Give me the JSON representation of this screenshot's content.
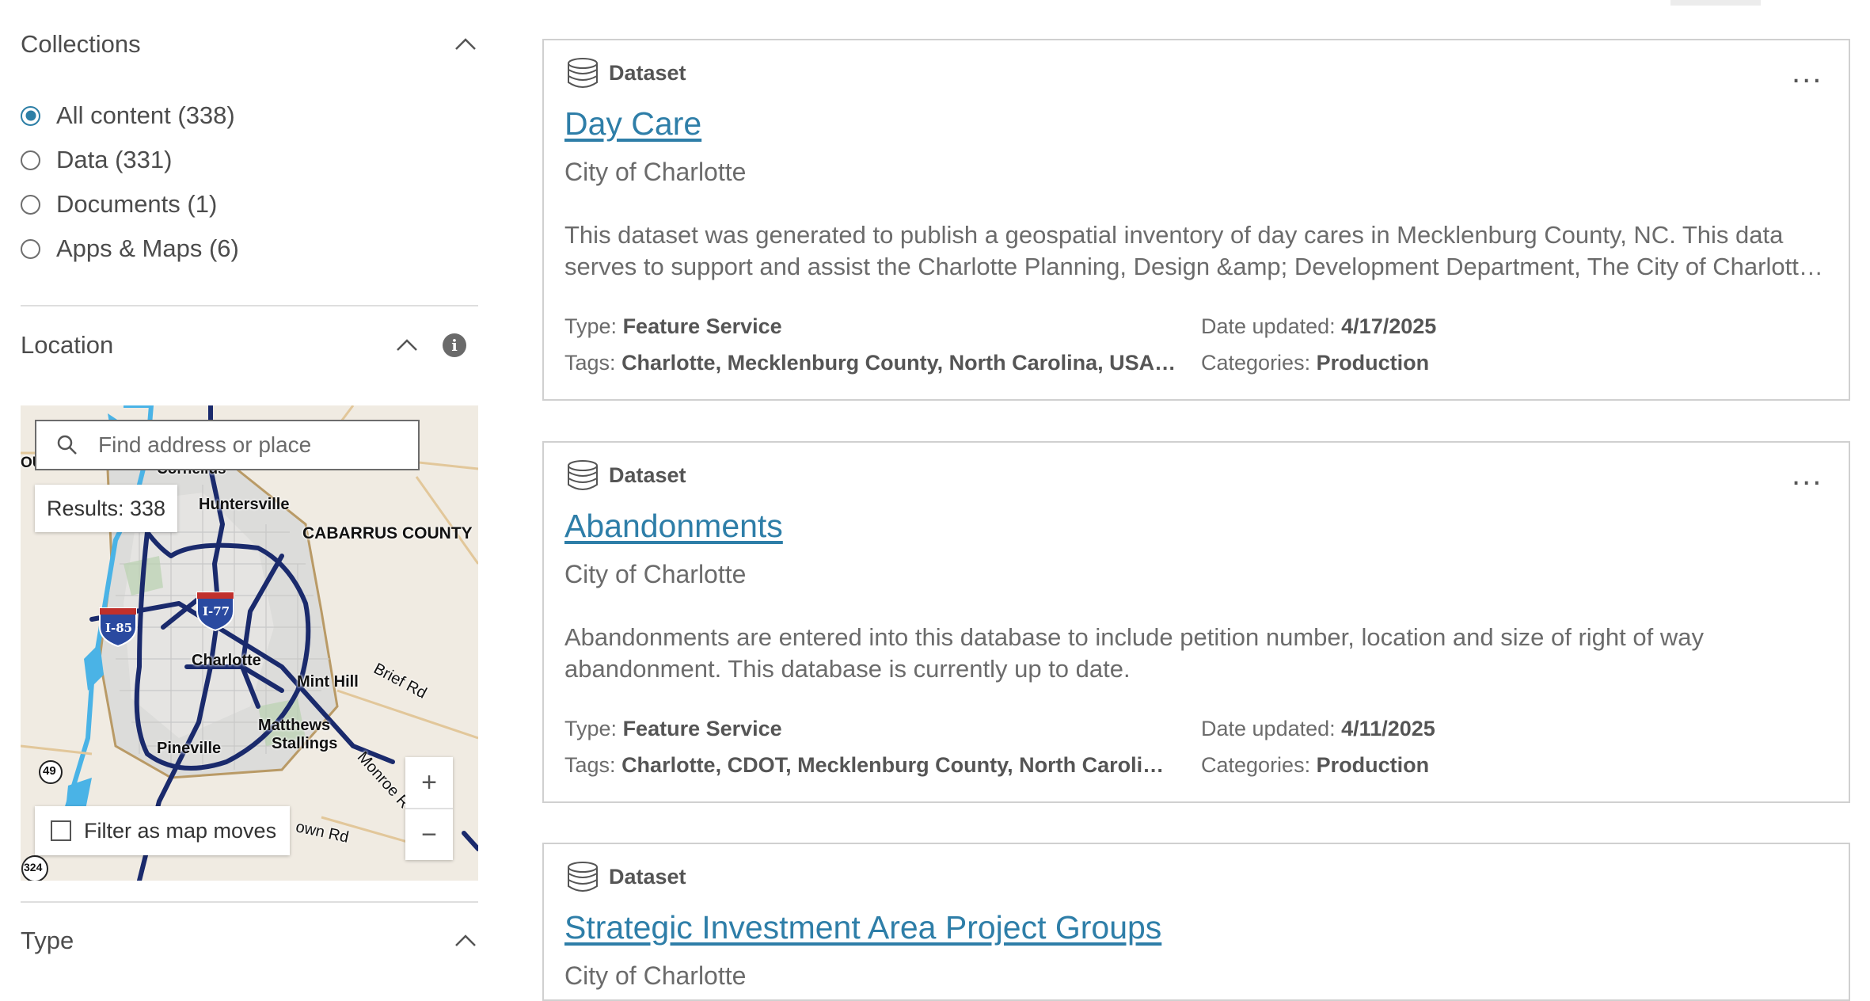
{
  "sidebar": {
    "collections": {
      "title": "Collections",
      "options": [
        {
          "label": "All content (338)",
          "selected": true
        },
        {
          "label": "Data (331)",
          "selected": false
        },
        {
          "label": "Documents (1)",
          "selected": false
        },
        {
          "label": "Apps & Maps (6)",
          "selected": false
        }
      ]
    },
    "location": {
      "title": "Location",
      "search_placeholder": "Find address or place",
      "results": "Results: 338",
      "filter_label": "Filter as map moves",
      "zoom_in": "+",
      "zoom_out": "−",
      "labels": {
        "cornelius": "Cornelius",
        "huntersville": "Huntersville",
        "cabarrus": "CABARRUS COUNTY",
        "charlotte": "Charlotte",
        "mint_hill": "Mint Hill",
        "matthews": "Matthews",
        "stallings": "Stallings",
        "pineville": "Pineville",
        "brief_rd": "Brief Rd",
        "monroe": "Monroe R",
        "own_rd": "own Rd",
        "ou": "OU",
        "i85": "I-85",
        "i77": "I-77",
        "r49": "49",
        "r324": "324"
      }
    },
    "type": {
      "title": "Type"
    }
  },
  "cards": [
    {
      "item_type": "Dataset",
      "title": "Day Care",
      "owner": "City of Charlotte",
      "description": "This dataset was generated to publish a geospatial inventory of day cares in Mecklenburg County, NC. This data serves to support and assist the Charlotte Planning, Design &amp; Development Department, The City of Charlotte and Mecklenburg County.",
      "type_label": "Type:",
      "type_value": "Feature Service",
      "tags_label": "Tags:",
      "tags_value": "Charlotte, Mecklenburg County, North Carolina, USA…",
      "date_label": "Date updated:",
      "date_value": "4/17/2025",
      "categories_label": "Categories:",
      "categories_value": "Production",
      "menu": "..."
    },
    {
      "item_type": "Dataset",
      "title": "Abandonments",
      "owner": "City of Charlotte",
      "description": "Abandonments are entered into this database to include petition number, location and size of right of way abandonment. This database is currently up to date.",
      "type_label": "Type:",
      "type_value": "Feature Service",
      "tags_label": "Tags:",
      "tags_value": "Charlotte, CDOT, Mecklenburg County, North Caroli…",
      "date_label": "Date updated:",
      "date_value": "4/11/2025",
      "categories_label": "Categories:",
      "categories_value": "Production",
      "menu": "..."
    },
    {
      "item_type": "Dataset",
      "title": "Strategic Investment Area Project Groups",
      "owner": "City of Charlotte"
    }
  ],
  "colors": {
    "accent": "#2e7ea8",
    "radio_selected": "#2d7fa6",
    "highway": "#1a2a6c",
    "water": "#4ab3e6"
  },
  "icons": [
    "chevron-up-icon",
    "info-icon",
    "search-icon",
    "database-icon",
    "more-options-icon"
  ]
}
